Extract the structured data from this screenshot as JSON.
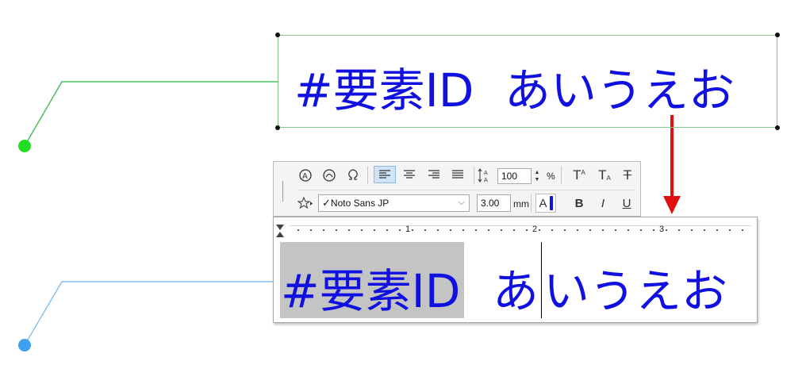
{
  "label_text": {
    "part1": "#要素ID",
    "part2": "あいうえお"
  },
  "editor_text": {
    "part1": "#要素ID",
    "part2": "あ",
    "part3": "いうえお"
  },
  "toolbar": {
    "line_spacing_value": "100",
    "line_spacing_unit": "%",
    "font_name": "Noto Sans JP",
    "font_check": "✓",
    "font_size_value": "3.00",
    "font_size_unit": "mm",
    "color_label": "A",
    "bold_label": "B",
    "italic_label": "I",
    "underline_label": "U",
    "superscript_label": "T",
    "superscript_mark": "A",
    "subscript_label": "T",
    "subscript_mark": "A",
    "strike_label": "T"
  },
  "ruler": {
    "marks": [
      "1",
      "2",
      "3"
    ]
  },
  "colors": {
    "text": "#1010e0",
    "arrow": "#e01010",
    "leader_green": "#4cbf5a",
    "leader_blue": "#6ab4ee",
    "dot_green": "#22dd22",
    "dot_blue": "#3ea0f0",
    "selection": "#c4c4c4"
  },
  "icons": [
    "text-style-a-icon",
    "text-style-curve-icon",
    "omega-icon",
    "align-left-icon",
    "align-center-icon",
    "align-right-icon",
    "align-justify-icon",
    "line-spacing-icon",
    "favorites-star-icon",
    "indent-marker-icon"
  ]
}
